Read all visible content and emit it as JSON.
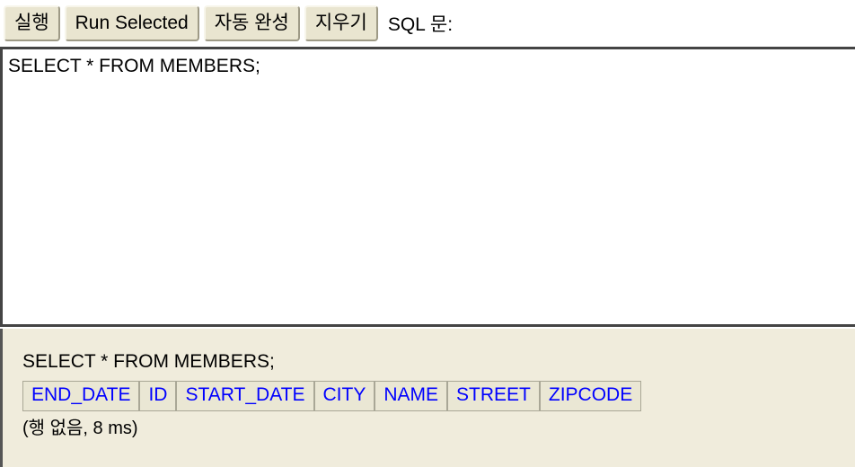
{
  "toolbar": {
    "buttons": [
      {
        "label": "실행",
        "name": "run-button"
      },
      {
        "label": "Run Selected",
        "name": "run-selected-button"
      },
      {
        "label": "자동 완성",
        "name": "autocomplete-button"
      },
      {
        "label": "지우기",
        "name": "clear-button"
      }
    ],
    "sql_label": "SQL 문:"
  },
  "editor": {
    "value": "SELECT * FROM MEMBERS;",
    "placeholder": ""
  },
  "results": {
    "query_echo": "SELECT * FROM MEMBERS;",
    "columns": [
      "END_DATE",
      "ID",
      "START_DATE",
      "CITY",
      "NAME",
      "STREET",
      "ZIPCODE"
    ],
    "rows": [],
    "status": "(행 없음, 8 ms)"
  },
  "colors": {
    "button_face": "#e9e5d0",
    "panel_background": "#f0ecdc",
    "header_text": "#0000ff",
    "editor_border": "#444444",
    "cell_border": "#a9a796"
  }
}
